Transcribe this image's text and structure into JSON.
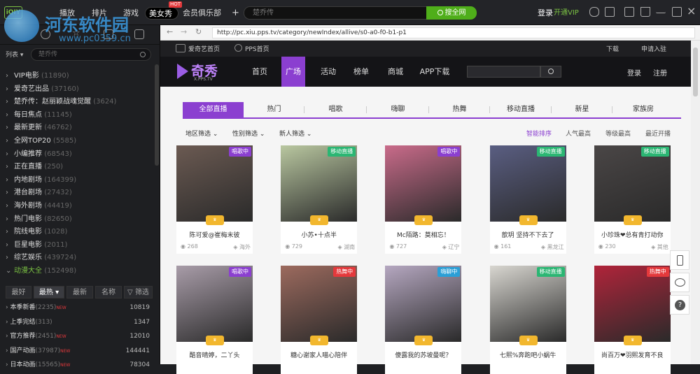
{
  "topbar": {
    "logo": "iQIY",
    "tabs": [
      {
        "label": "播放"
      },
      {
        "label": "排片"
      },
      {
        "label": "游戏"
      },
      {
        "label": "美女秀",
        "badge": "HOT"
      },
      {
        "label": "会员俱乐部"
      }
    ],
    "add_tab": "+",
    "search_placeholder": "楚乔传",
    "search_button": "搜全网",
    "login": "登录",
    "vip": "开通VIP"
  },
  "left_panel": {
    "list_label": "列表",
    "search_placeholder": "楚乔传",
    "categories": [
      {
        "label": "VIP电影",
        "count": "(11890)"
      },
      {
        "label": "爱奇艺出品",
        "count": "(37160)"
      },
      {
        "label": "楚乔传：赵丽颖战魂觉醒",
        "count": "(3624)"
      },
      {
        "label": "每日焦点",
        "count": "(11145)"
      },
      {
        "label": "最新更新",
        "count": "(46762)"
      },
      {
        "label": "全网TOP20",
        "count": "(5585)"
      },
      {
        "label": "小编推荐",
        "count": "(68543)"
      },
      {
        "label": "正在直播",
        "count": "(250)"
      },
      {
        "label": "内地剧场",
        "count": "(164399)"
      },
      {
        "label": "港台剧场",
        "count": "(27432)"
      },
      {
        "label": "海外剧场",
        "count": "(44419)"
      },
      {
        "label": "热门电影",
        "count": "(82650)"
      },
      {
        "label": "院线电影",
        "count": "(1028)"
      },
      {
        "label": "巨星电影",
        "count": "(2011)"
      },
      {
        "label": "综艺娱乐",
        "count": "(439724)"
      },
      {
        "label": "动漫大全",
        "count": "(152498)"
      }
    ],
    "sub_tabs": [
      "最好",
      "最热",
      "最新",
      "名称",
      "筛选"
    ],
    "sub_items": [
      {
        "label": "本季新番",
        "count": "(2235)",
        "new": "NEW",
        "num": "10819"
      },
      {
        "label": "上季完结",
        "count": "(313)",
        "new": "",
        "num": "1347"
      },
      {
        "label": "官方推荐",
        "count": "(2451)",
        "new": "NEW",
        "num": "12010"
      },
      {
        "label": "国产动画",
        "count": "(37987)",
        "new": "NEW",
        "num": "144441"
      },
      {
        "label": "日本动画",
        "count": "(15565)",
        "new": "NEW",
        "num": "78304"
      }
    ]
  },
  "browser": {
    "url": "http://pc.xiu.pps.tv/category/newIndex/allive/s0-a0-f0-b1-p1",
    "bookmarks": [
      "爱奇艺首页",
      "PPS首页"
    ],
    "bookmark_right": [
      "下载",
      "申请入驻"
    ]
  },
  "site": {
    "logo_text": "奇秀",
    "logo_sub": "X.PPS.TV",
    "nav": [
      "首页",
      "广场",
      "活动",
      "榜单",
      "商城",
      "APP下载"
    ],
    "login": "登录",
    "register": "注册",
    "categories": [
      "全部直播",
      "热门",
      "唱歌",
      "嗨聊",
      "热舞",
      "移动直播",
      "新星",
      "家族房"
    ],
    "filters": [
      "地区筛选",
      "性别筛选",
      "新人筛选"
    ],
    "sorts": [
      "智能排序",
      "人气最高",
      "等级最高",
      "最近开播"
    ],
    "cards": [
      {
        "tag": "唱歌中",
        "tag_color": "#8b3fd0",
        "name": "陈可爱@崔梅末彼",
        "viewers": "268",
        "location": "海外",
        "bg": "#6b5a52"
      },
      {
        "tag": "移动直播",
        "tag_color": "#2bb673",
        "name": "小苏•十点半",
        "viewers": "729",
        "location": "湖南",
        "bg": "#b9c7a0"
      },
      {
        "tag": "唱歌中",
        "tag_color": "#8b3fd0",
        "name": "Mc陌路：莫相忘！",
        "viewers": "727",
        "location": "辽宁",
        "bg": "#c96b8a"
      },
      {
        "tag": "移动直播",
        "tag_color": "#2bb673",
        "name": "歆玥 坚持不下去了",
        "viewers": "161",
        "location": "黑龙江",
        "bg": "#5a5e82"
      },
      {
        "tag": "移动直播",
        "tag_color": "#2bb673",
        "name": "小珍珠❤总有青打动你",
        "viewers": "230",
        "location": "其他",
        "bg": "#4a4646"
      },
      {
        "tag": "唱歌中",
        "tag_color": "#8b3fd0",
        "name": "酷音晴婷，二丫头",
        "viewers": "",
        "location": "",
        "bg": "#a89ca8"
      },
      {
        "tag": "热舞中",
        "tag_color": "#e4393c",
        "name": "糖心谢家人喵心陪伴",
        "viewers": "",
        "location": "",
        "bg": "#9c6a5e"
      },
      {
        "tag": "嗨聊中",
        "tag_color": "#2b9fd6",
        "name": "傻露我的苏坡曼呢？",
        "viewers": "",
        "location": "",
        "bg": "#b5a7c0"
      },
      {
        "tag": "移动直播",
        "tag_color": "#2bb673",
        "name": "七熙%奔跑吧小蜗牛",
        "viewers": "",
        "location": "",
        "bg": "#d8d6d0"
      },
      {
        "tag": "热舞中",
        "tag_color": "#e4393c",
        "name": "尚百万❤羽熙发育不良",
        "viewers": "",
        "location": "",
        "bg": "#b0243a"
      }
    ]
  },
  "watermark": {
    "title": "河东软件园",
    "url": "www.pc0359.cn"
  }
}
